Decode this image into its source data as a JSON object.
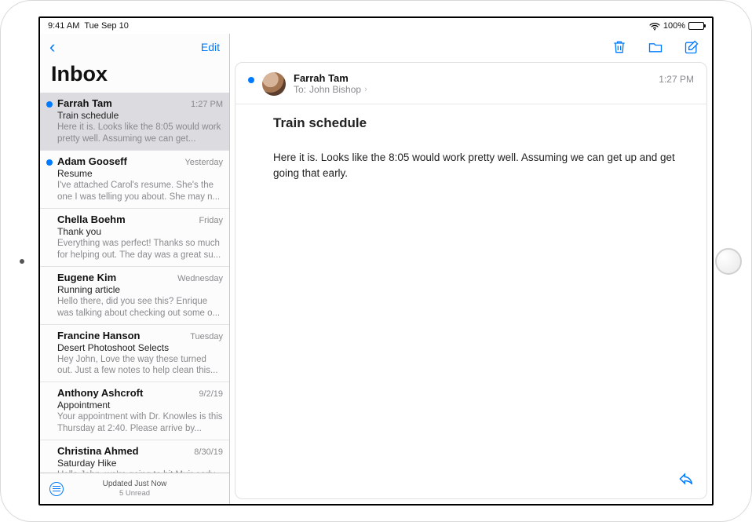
{
  "status": {
    "time": "9:41 AM",
    "date": "Tue Sep 10",
    "battery_pct": "100%"
  },
  "sidebar": {
    "edit_label": "Edit",
    "title": "Inbox",
    "footer_main": "Updated Just Now",
    "footer_sub": "5 Unread"
  },
  "mails": [
    {
      "sender": "Farrah Tam",
      "time": "1:27 PM",
      "subject": "Train schedule",
      "preview": "Here it is. Looks like the 8:05 would work pretty well. Assuming we can get...",
      "unread": true,
      "selected": true
    },
    {
      "sender": "Adam Gooseff",
      "time": "Yesterday",
      "subject": "Resume",
      "preview": "I've attached Carol's resume. She's the one I was telling you about. She may n...",
      "unread": true,
      "selected": false
    },
    {
      "sender": "Chella Boehm",
      "time": "Friday",
      "subject": "Thank you",
      "preview": "Everything was perfect! Thanks so much for helping out. The day was a great su...",
      "unread": false,
      "selected": false
    },
    {
      "sender": "Eugene Kim",
      "time": "Wednesday",
      "subject": "Running article",
      "preview": "Hello there, did you see this? Enrique was talking about checking out some o...",
      "unread": false,
      "selected": false
    },
    {
      "sender": "Francine Hanson",
      "time": "Tuesday",
      "subject": "Desert Photoshoot Selects",
      "preview": "Hey John, Love the way these turned out. Just a few notes to help clean this...",
      "unread": false,
      "selected": false
    },
    {
      "sender": "Anthony Ashcroft",
      "time": "9/2/19",
      "subject": "Appointment",
      "preview": "Your appointment with Dr. Knowles is this Thursday at 2:40. Please arrive by...",
      "unread": false,
      "selected": false
    },
    {
      "sender": "Christina Ahmed",
      "time": "8/30/19",
      "subject": "Saturday Hike",
      "preview": "Hello John, we're going to hit Muir early",
      "unread": false,
      "selected": false
    }
  ],
  "message": {
    "from": "Farrah Tam",
    "to_label": "To:",
    "to": "John Bishop",
    "time": "1:27 PM",
    "subject": "Train schedule",
    "body": "Here it is. Looks like the 8:05 would work pretty well. Assuming we can get up and get going that early."
  }
}
